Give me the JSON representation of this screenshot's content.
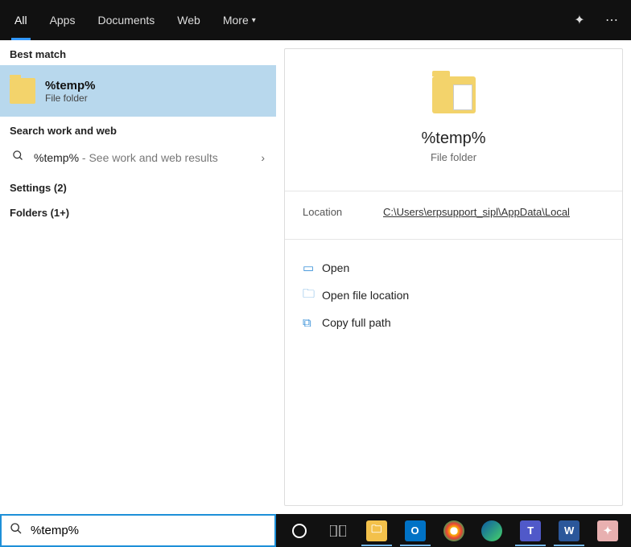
{
  "tabs": {
    "all": "All",
    "apps": "Apps",
    "documents": "Documents",
    "web": "Web",
    "more": "More"
  },
  "sections": {
    "best": "Best match",
    "searchww": "Search work and web",
    "settings": "Settings (2)",
    "folders": "Folders (1+)"
  },
  "best": {
    "title": "%temp%",
    "subtitle": "File folder"
  },
  "webrow": {
    "query": "%temp%",
    "hint": " - See work and web results"
  },
  "preview": {
    "title": "%temp%",
    "subtitle": "File folder",
    "location_label": "Location",
    "location_value": "C:\\Users\\erpsupport_sipl\\AppData\\Local"
  },
  "actions": {
    "open": "Open",
    "openloc": "Open file location",
    "copypath": "Copy full path"
  },
  "search": {
    "value": "%temp%"
  }
}
